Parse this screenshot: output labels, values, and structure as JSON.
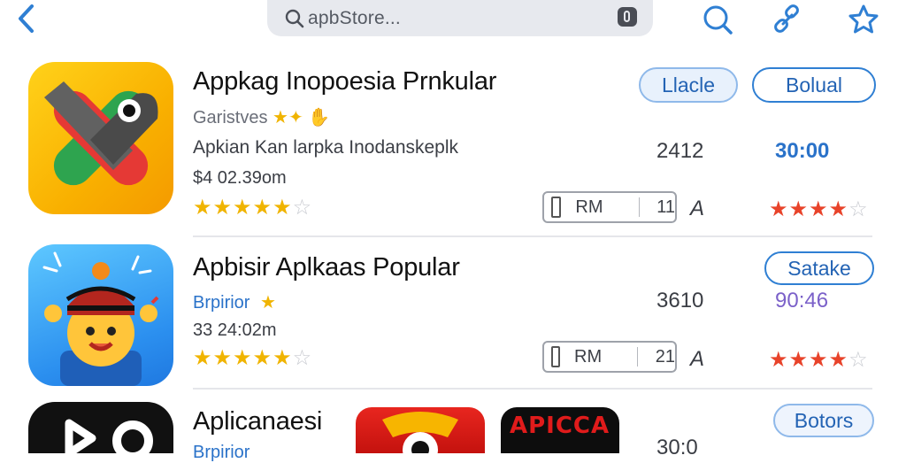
{
  "search": {
    "placeholder": "apbStore..."
  },
  "apps": [
    {
      "title": "Appkag Inopoesia Prnkular",
      "subtitle": "Garistves",
      "description": "Apkian Kan larpka Inodanskeplk",
      "price": "$4 02.39om",
      "rating": 4.5,
      "count": "2412",
      "time": "30:00",
      "rm_label": "RM",
      "rm_value": "11",
      "a_letter": "A",
      "pill_soft": "Llacle",
      "pill": "Bolual",
      "right_rating": 4
    },
    {
      "title": "Apbisir Aplkaas Popular",
      "subtitle": "Brpirior",
      "price": "33 24:02m",
      "rating": 4.5,
      "count": "3610",
      "time": "90:46",
      "rm_label": "RM",
      "rm_value": "21",
      "a_letter": "A",
      "pill": "Satake",
      "right_rating": 4
    },
    {
      "title": "Aplicanaesi",
      "subtitle": "Brpirior",
      "count": "30:0",
      "pill": "Botors",
      "tile_text": "APICCA"
    }
  ],
  "colors": {
    "accent": "#2f7fd3",
    "star": "#f0b400",
    "red_star": "#e8432a"
  }
}
